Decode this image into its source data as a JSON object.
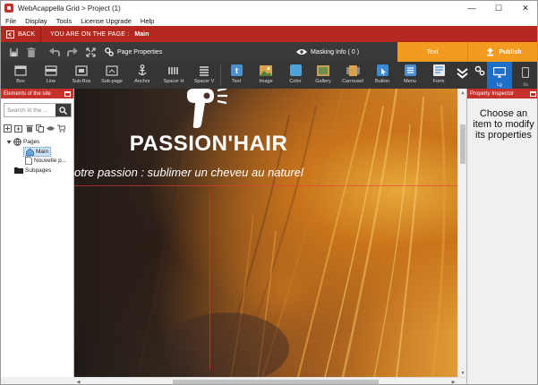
{
  "window": {
    "title": "WebAcappella Grid > Project (1)",
    "minimize": "—",
    "maximize": "☐",
    "close": "✕"
  },
  "menu": [
    "File",
    "Display",
    "Tools",
    "License Upgrade",
    "Help"
  ],
  "redbar": {
    "back_label": "BACK",
    "you_are_label": "YOU ARE ON THE PAGE :",
    "page_name": "Main"
  },
  "toolbar": {
    "page_properties_label": "Page Properties",
    "masking_label": "Masking Info ( 0 )",
    "text_tab_label": "Text",
    "publish_label": "Publish"
  },
  "components": [
    {
      "label": "Box",
      "icon": "box-icon"
    },
    {
      "label": "Line",
      "icon": "line-icon"
    },
    {
      "label": "Sub-Box",
      "icon": "sub-box-icon"
    },
    {
      "label": "Sub-page",
      "icon": "sub-page-icon"
    },
    {
      "label": "Anchor",
      "icon": "anchor-icon"
    },
    {
      "label": "Spacer H",
      "icon": "spacer-h-icon"
    },
    {
      "label": "Spacer V",
      "icon": "spacer-v-icon"
    },
    {
      "label": "Text",
      "icon": "text-icon"
    },
    {
      "label": "Image",
      "icon": "image-icon"
    },
    {
      "label": "Color",
      "icon": "color-icon"
    },
    {
      "label": "Gallery",
      "icon": "gallery-icon"
    },
    {
      "label": "Carrousel",
      "icon": "carrousel-icon"
    },
    {
      "label": "Button",
      "icon": "button-icon"
    },
    {
      "label": "Menu",
      "icon": "menu-icon"
    },
    {
      "label": "Form",
      "icon": "form-icon"
    }
  ],
  "devices": {
    "lg": "Lg",
    "xs": "Xs"
  },
  "left_panel": {
    "title": "Elements of the site",
    "search_placeholder": "Search in the ...",
    "tree": {
      "pages": "Pages",
      "main": "Main",
      "nouvelle": "Nouvelle p...",
      "subpages": "Subpages"
    }
  },
  "canvas": {
    "brand": "PASSION'HAIR",
    "tagline": "otre passion : sublimer un cheveu au naturel"
  },
  "right_panel": {
    "title": "Property Inspector",
    "message": "Choose an item to modify its properties"
  },
  "colors": {
    "accent_red": "#c8312b",
    "accent_orange": "#f29b1e",
    "toolbar_dark": "#353535",
    "device_blue": "#1e6fc7"
  }
}
